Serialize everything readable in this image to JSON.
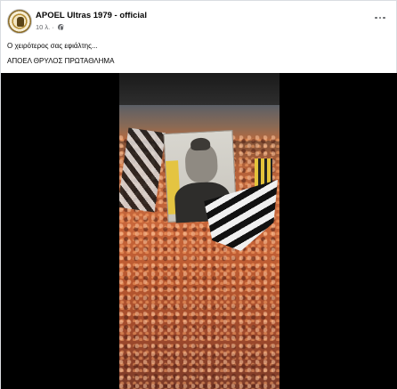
{
  "post": {
    "author": "APOEL Ultras 1979 - official",
    "time": "10 λ.",
    "privacy_separator": "·",
    "caption_line1": "Ο χειρότερος σας εφιάλτης...",
    "caption_line2": "ΑΠΟΕΛ ΘΡΥΛΟΣ ΠΡΩΤΑΘΛΗΜΑ"
  },
  "icons": {
    "privacy": "globe-icon",
    "menu": "more-options-icon"
  },
  "colors": {
    "name_text": "#050505",
    "meta_text": "#65676b",
    "video_background": "#000000"
  }
}
